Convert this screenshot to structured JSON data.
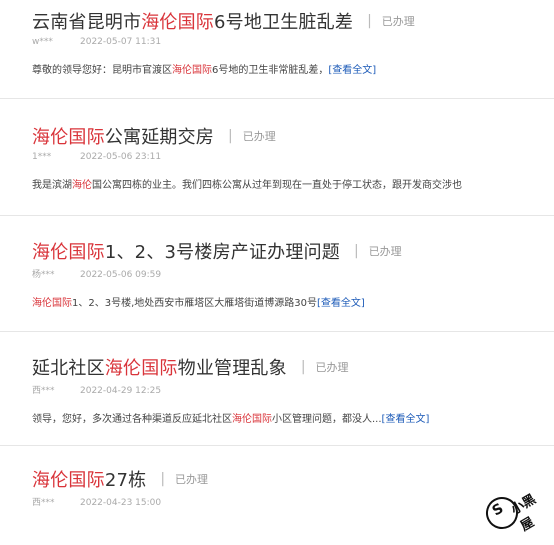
{
  "items": [
    {
      "title_parts": [
        "云南省昆明市",
        "海伦国际",
        "6号地卫生脏乱差"
      ],
      "status": "已办理",
      "user": "w***",
      "date": "2022-05-07 11:31",
      "excerpt_parts": [
        "尊敬的领导您好：昆明市官渡区",
        "海伦国际",
        "6号地的卫生非常脏乱差，"
      ],
      "more": "[查看全文]"
    },
    {
      "title_parts": [
        "",
        "海伦国际",
        "公寓延期交房"
      ],
      "status": "已办理",
      "user": "1***",
      "date": "2022-05-06 23:11",
      "excerpt_parts": [
        "我是滨湖",
        "海伦",
        "国公寓四栋的业主。我们四栋公寓从过年到现在一直处于停工状态，跟开发商交涉也"
      ],
      "more": ""
    },
    {
      "title_parts": [
        "",
        "海伦国际",
        "1、2、3号楼房产证办理问题"
      ],
      "status": "已办理",
      "user": "杨***",
      "date": "2022-05-06 09:59",
      "excerpt_parts": [
        "",
        "海伦国际",
        "1、2、3号楼,地处西安市雁塔区大雁塔街道博源路30号"
      ],
      "more": "[查看全文]"
    },
    {
      "title_parts": [
        "延北社区",
        "海伦国际",
        "物业管理乱象"
      ],
      "status": "已办理",
      "user": "西***",
      "date": "2022-04-29 12:25",
      "excerpt_parts": [
        "领导，您好，多次通过各种渠道反应延北社区",
        "海伦国际",
        "小区管理问题，都没人..."
      ],
      "more": "[查看全文]"
    },
    {
      "title_parts": [
        "",
        "海伦国际",
        "27栋"
      ],
      "status": "已办理",
      "user": "西***",
      "date": "2022-04-23 15:00",
      "excerpt_parts": [
        "",
        "",
        ""
      ],
      "more": ""
    }
  ],
  "watermark": {
    "glyph": "S",
    "word": "小黑屋"
  }
}
